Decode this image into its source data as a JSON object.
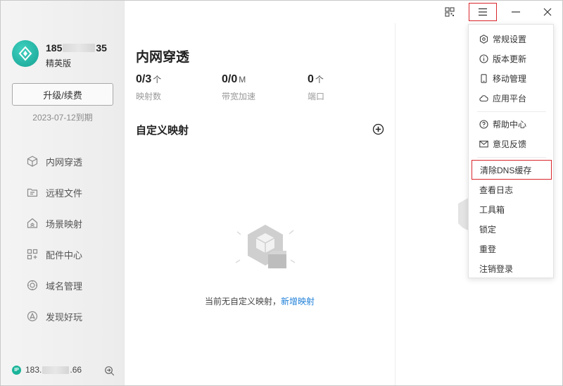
{
  "titlebar": {
    "qr_icon": "qrcode-icon",
    "menu_icon": "hamburger-menu-icon",
    "minimize_icon": "minimize-icon",
    "close_icon": "close-icon",
    "highlight_color": "#d9262c"
  },
  "sidebar": {
    "user": {
      "phone_prefix": "185",
      "phone_suffix": "35",
      "plan": "精英版"
    },
    "upgrade_label": "升级/续费",
    "expire_text": "2023-07-12到期",
    "items": [
      {
        "label": "内网穿透",
        "icon": "cube-icon"
      },
      {
        "label": "远程文件",
        "icon": "folder-icon"
      },
      {
        "label": "场景映射",
        "icon": "home-icon"
      },
      {
        "label": "配件中心",
        "icon": "grid-icon"
      },
      {
        "label": "域名管理",
        "icon": "globe-icon"
      },
      {
        "label": "发现好玩",
        "icon": "compass-icon"
      }
    ],
    "ip": {
      "badge": "IP",
      "prefix": "183.",
      "suffix": ".66"
    }
  },
  "main": {
    "title": "内网穿透",
    "stats": [
      {
        "value": "0/3",
        "unit": "个",
        "label": "映射数"
      },
      {
        "value": "0/0",
        "unit": "M",
        "label": "带宽加速"
      },
      {
        "value": "0",
        "unit": "个",
        "label": "端口"
      }
    ],
    "section_title": "自定义映射",
    "empty_text": "当前无自定义映射，",
    "empty_link": "新增映射",
    "accent_color": "#1e7fd8"
  },
  "menu": {
    "group1": [
      {
        "label": "常规设置",
        "icon": "settings-icon"
      },
      {
        "label": "版本更新",
        "icon": "info-icon"
      },
      {
        "label": "移动管理",
        "icon": "phone-icon"
      },
      {
        "label": "应用平台",
        "icon": "cloud-icon"
      }
    ],
    "group2": [
      {
        "label": "帮助中心",
        "icon": "help-icon"
      },
      {
        "label": "意见反馈",
        "icon": "mail-icon"
      }
    ],
    "group3": [
      {
        "label": "清除DNS缓存"
      },
      {
        "label": "查看日志"
      },
      {
        "label": "工具箱"
      },
      {
        "label": "锁定"
      },
      {
        "label": "重登"
      },
      {
        "label": "注销登录"
      }
    ]
  }
}
